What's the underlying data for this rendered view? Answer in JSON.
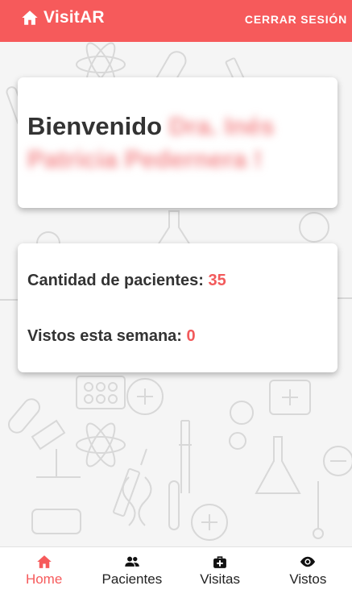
{
  "header": {
    "brand": "VisitAR",
    "logout_label": "CERRAR SESIÓN",
    "background": "#f65a5b"
  },
  "welcome_card": {
    "greeting": "Bienvenido",
    "user_name": "Dra. Inés Patricia Pedernera !"
  },
  "stats_card": {
    "patients_label": "Cantidad de pacientes:",
    "patients_value": "35",
    "seen_label": "Vistos esta semana:",
    "seen_value": "0",
    "value_color": "#f25a5b"
  },
  "bottom_nav": {
    "items": [
      {
        "label": "Home",
        "icon": "home-icon",
        "active": true
      },
      {
        "label": "Pacientes",
        "icon": "people-icon",
        "active": false
      },
      {
        "label": "Visitas",
        "icon": "medical-bag-icon",
        "active": false
      },
      {
        "label": "Vistos",
        "icon": "eye-icon",
        "active": false
      }
    ]
  }
}
